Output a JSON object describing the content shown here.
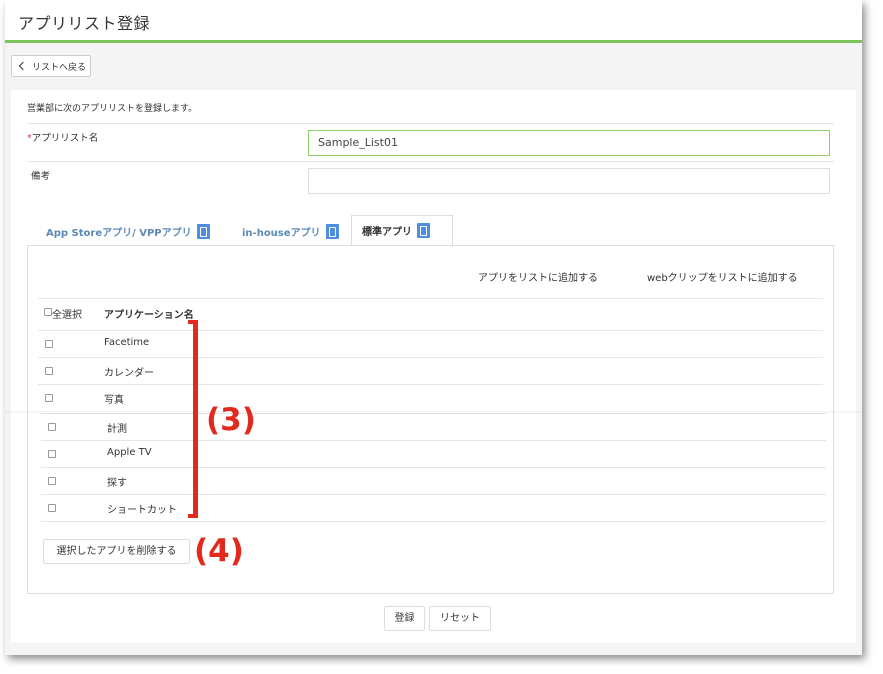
{
  "header": {
    "title": "アプリリスト登録"
  },
  "nav": {
    "back_label": "リストへ戻る"
  },
  "form": {
    "intro": "営業部に次のアプリリストを登録します。",
    "name_label": "アプリリスト名",
    "name_required_mark": "*",
    "name_value": "Sample_List01",
    "note_label": "備考",
    "note_value": ""
  },
  "tabs": [
    {
      "label": "App Storeアプリ/ VPPアプリ",
      "active": false
    },
    {
      "label": "in-houseアプリ",
      "active": false
    },
    {
      "label": "標準アプリ",
      "active": true
    }
  ],
  "actions": {
    "add_app": "アプリをリストに追加する",
    "add_webclip": "webクリップをリストに追加する"
  },
  "table": {
    "select_all": "全選択",
    "col_app_name": "アプリケーション名",
    "rows": [
      "Facetime",
      "カレンダー",
      "写真",
      "計測",
      "Apple TV",
      "探す",
      "ショートカット"
    ]
  },
  "buttons": {
    "delete_selected": "選択したアプリを削除する",
    "register": "登録",
    "reset": "リセット"
  },
  "annotations": {
    "callout_3": "(3)",
    "callout_4": "(4)"
  },
  "colors": {
    "accent_green": "#7cc35a",
    "tab_blue": "#4e8ee0",
    "annotation_red": "#e12a1d"
  }
}
